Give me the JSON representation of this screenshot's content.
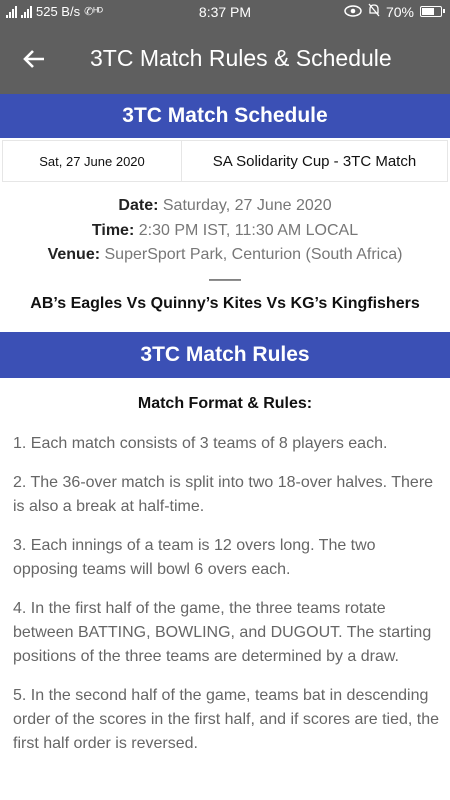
{
  "status_bar": {
    "network": "525 B/s",
    "time": "8:37 PM",
    "battery": "70%",
    "battery_level": 0.7
  },
  "app_bar": {
    "title": "3TC Match Rules & Schedule"
  },
  "schedule": {
    "header": "3TC Match Schedule",
    "date_cell": "Sat, 27 June 2020",
    "event_cell": "SA Solidarity Cup - 3TC Match",
    "date_label": "Date:",
    "date_value": "Saturday, 27 June 2020",
    "time_label": "Time:",
    "time_value": "2:30 PM IST, 11:30 AM LOCAL",
    "venue_label": "Venue:",
    "venue_value": "SuperSport Park, Centurion (South Africa)",
    "separator": "——",
    "teams": "AB’s Eagles Vs Quinny’s Kites Vs KG’s Kingfishers"
  },
  "rules": {
    "header": "3TC Match Rules",
    "subtitle": "Match Format & Rules:",
    "items": [
      "1. Each match consists of 3 teams of 8 players each.",
      "2. The 36-over match is split into two 18-over halves. There is also a break at half-time.",
      "3. Each innings of a team is 12 overs long. The two opposing teams will bowl 6 overs each.",
      "4. In the first half of the game, the three teams rotate between BATTING, BOWLING, and DUGOUT. The starting positions of the three teams are determined by a draw.",
      "5. In the second half of the game, teams bat in descending order of the scores in the first half, and if scores are tied, the first half order is reversed."
    ]
  },
  "colors": {
    "app_bar": "#5f5f5f",
    "section_header": "#3b50b5",
    "muted_text": "#777777"
  }
}
